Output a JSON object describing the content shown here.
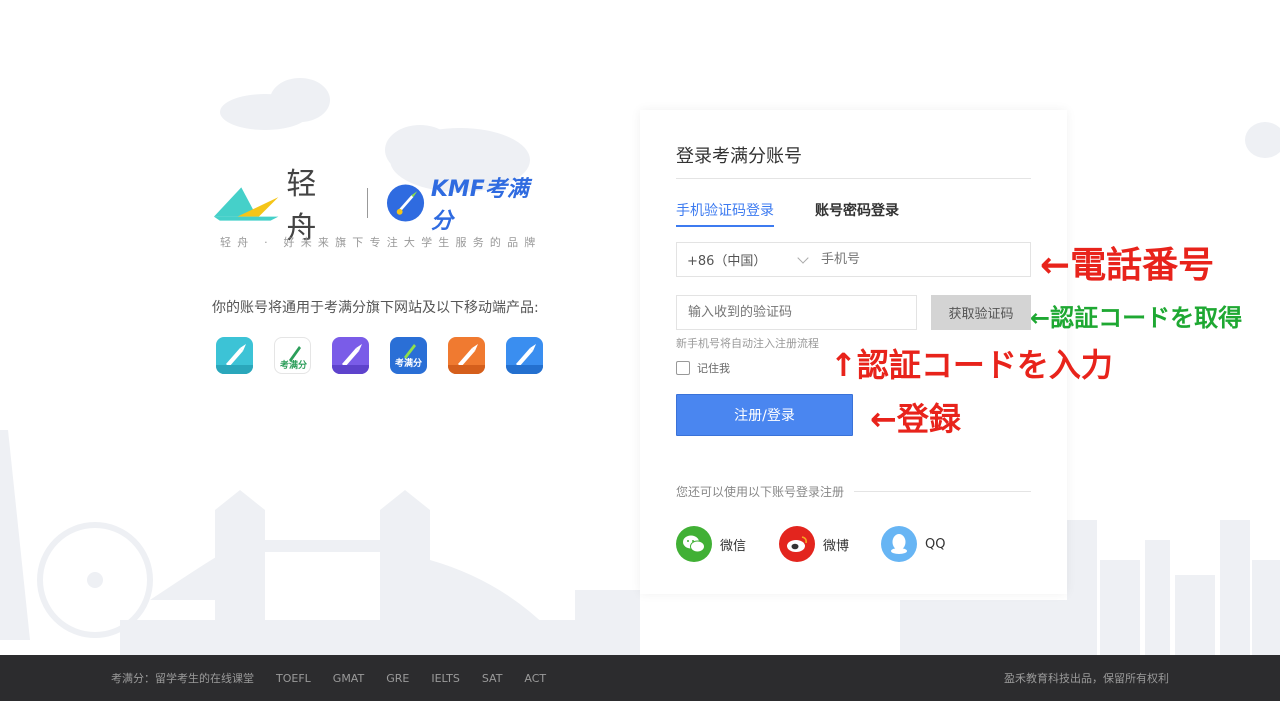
{
  "brand": {
    "name_qz": "轻舟",
    "name_kmf": "KMF考满分",
    "tagline": "轻舟 · 好未来旗下专注大学生服务的品牌"
  },
  "note": "你的账号将通用于考满分旗下网站及以下移动端产品:",
  "apps": [
    {
      "icon": "rocket-app-icon",
      "color": "#3cc3d6"
    },
    {
      "icon": "kmf-green-app-icon",
      "color": "#ffffff"
    },
    {
      "icon": "rocket-purple-app-icon",
      "color": "#7a5ce8"
    },
    {
      "icon": "kmf-blue-app-icon",
      "color": "#2a6fd6"
    },
    {
      "icon": "rocket-orange-app-icon",
      "color": "#f07a30"
    },
    {
      "icon": "rocket-blue-app-icon",
      "color": "#3a8ef0"
    }
  ],
  "login": {
    "title": "登录考满分账号",
    "tab_sms": "手机验证码登录",
    "tab_password": "账号密码登录",
    "country_code": "+86（中国）",
    "phone_placeholder": "手机号",
    "code_placeholder": "输入收到的验证码",
    "get_code_label": "获取验证码",
    "hint": "新手机号将自动注入注册流程",
    "remember_label": "记住我",
    "submit_label": "注册/登录",
    "alt_label": "您还可以使用以下账号登录注册",
    "social": {
      "wechat": "微信",
      "weibo": "微博",
      "qq": "QQ"
    }
  },
  "annotations": {
    "phone": "←電話番号",
    "get_code": "←認証コードを取得",
    "enter_code": "↑認証コードを入力",
    "register": "←登録"
  },
  "footer": {
    "site": "考满分：留学考生的在线课堂",
    "links": [
      "TOEFL",
      "GMAT",
      "GRE",
      "IELTS",
      "SAT",
      "ACT"
    ],
    "copyright": "盈禾教育科技出品，保留所有权利"
  },
  "colors": {
    "accent": "#3d7bf0",
    "submit": "#4a86f0",
    "annotation_red": "#e8231b",
    "annotation_green": "#1ea832",
    "footer_bg": "#2c2c2e"
  }
}
